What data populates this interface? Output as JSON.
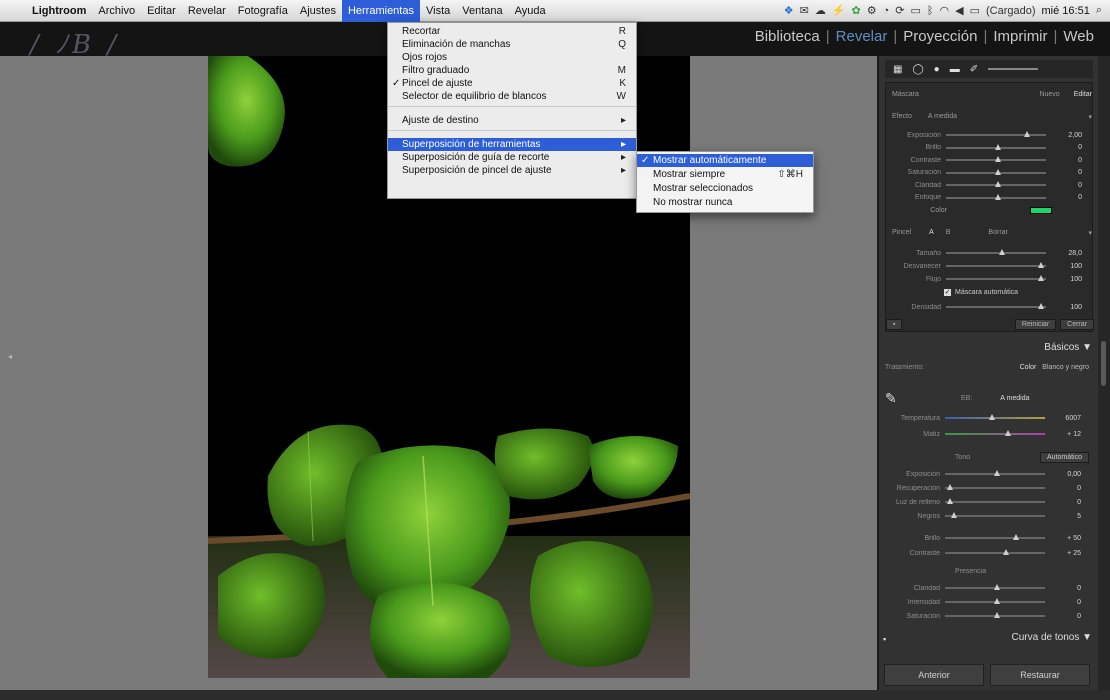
{
  "menubar": {
    "app": "Lightroom",
    "items": [
      "Archivo",
      "Editar",
      "Revelar",
      "Fotografía",
      "Ajustes",
      "Herramientas",
      "Vista",
      "Ventana",
      "Ayuda"
    ],
    "active_index": 5,
    "status": {
      "battery": "(Cargado)",
      "clock": "mié 16:51"
    }
  },
  "modules": {
    "items": [
      "Biblioteca",
      "Revelar",
      "Proyección",
      "Imprimir",
      "Web"
    ],
    "active_index": 1
  },
  "herramientas_menu": {
    "items": [
      {
        "label": "Recortar",
        "shortcut": "R"
      },
      {
        "label": "Eliminación de manchas",
        "shortcut": "Q"
      },
      {
        "label": "Ojos rojos",
        "shortcut": ""
      },
      {
        "label": "Filtro graduado",
        "shortcut": "M"
      },
      {
        "label": "Pincel de ajuste",
        "shortcut": "K",
        "checked": true
      },
      {
        "label": "Selector de equilibrio de blancos",
        "shortcut": "W"
      },
      {
        "label": "Ajuste de destino",
        "shortcut": "▸"
      },
      {
        "label": "Superposición de herramientas",
        "shortcut": "▸",
        "highlighted": true
      },
      {
        "label": "Superposición de guía de recorte",
        "shortcut": "▸"
      },
      {
        "label": "Superposición de pincel de ajuste",
        "shortcut": "▸"
      }
    ]
  },
  "superposicion_submenu": {
    "items": [
      {
        "label": "Mostrar automáticamente",
        "shortcut": "",
        "checked": true,
        "highlighted": true
      },
      {
        "label": "Mostrar siempre",
        "shortcut": "⇧⌘H"
      },
      {
        "label": "Mostrar seleccionados",
        "shortcut": ""
      },
      {
        "label": "No mostrar nunca",
        "shortcut": ""
      }
    ]
  },
  "brush_panel": {
    "mask_label": "Máscara",
    "new_label": "Nuevo",
    "edit_label": "Editar",
    "effect_label": "Efecto",
    "effect_value": "A medida",
    "sliders": [
      {
        "label": "Exposición",
        "value": "2,00",
        "pos": 0.8
      },
      {
        "label": "Brillo",
        "value": "0",
        "pos": 0.5
      },
      {
        "label": "Contraste",
        "value": "0",
        "pos": 0.5
      },
      {
        "label": "Saturación",
        "value": "0",
        "pos": 0.5
      },
      {
        "label": "Claridad",
        "value": "0",
        "pos": 0.5
      },
      {
        "label": "Enfoque",
        "value": "0",
        "pos": 0.5
      }
    ],
    "color_label": "Color",
    "brush_label": "Pincel",
    "brush_a": "A",
    "brush_b": "B",
    "erase_label": "Borrar",
    "brush_sliders": [
      {
        "label": "Tamaño",
        "value": "28,0",
        "pos": 0.55
      },
      {
        "label": "Desvanecer",
        "value": "100",
        "pos": 0.95
      },
      {
        "label": "Flujo",
        "value": "100",
        "pos": 0.95
      }
    ],
    "automask_label": "Máscara automática",
    "density_label": "Densidad",
    "density_value": "100",
    "reset_label": "Reiniciar",
    "close_label": "Cerrar"
  },
  "basicos": {
    "title": "Básicos ▼",
    "treatment_label": "Tratamiento:",
    "color_label": "Color",
    "bw_label": "Blanco y negro",
    "wb_label": "EB:",
    "wb_value": "A medida",
    "temp": {
      "label": "Temperatura",
      "value": "6007",
      "pos": 0.45
    },
    "tint": {
      "label": "Matiz",
      "value": "+ 12",
      "pos": 0.62
    },
    "tone_label": "Tono",
    "auto_label": "Automático",
    "tone_sliders": [
      {
        "label": "Exposición",
        "value": "0,00",
        "pos": 0.5
      },
      {
        "label": "Recuperación",
        "value": "0",
        "pos": 0.02
      },
      {
        "label": "Luz de relleno",
        "value": "0",
        "pos": 0.02
      },
      {
        "label": "Negros",
        "value": "5",
        "pos": 0.06
      },
      {
        "label": "Brillo",
        "value": "+ 50",
        "pos": 0.7
      },
      {
        "label": "Contraste",
        "value": "+ 25",
        "pos": 0.6
      }
    ],
    "presence_label": "Presencia",
    "presence_sliders": [
      {
        "label": "Claridad",
        "value": "0",
        "pos": 0.5
      },
      {
        "label": "Intensidad",
        "value": "0",
        "pos": 0.5
      },
      {
        "label": "Saturación",
        "value": "0",
        "pos": 0.5
      }
    ]
  },
  "curva_title": "Curva de tonos ▼",
  "bottom": {
    "prev_label": "Anterior",
    "reset_label": "Restaurar"
  },
  "colors": {
    "menu_highlight": "#2d5ed8",
    "module_active": "#5f8fc0",
    "mask_color": "#1fd36a"
  }
}
